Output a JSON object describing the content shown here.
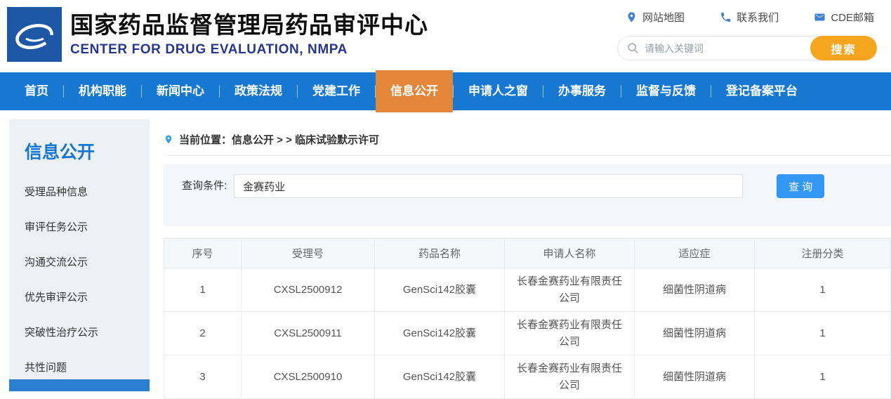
{
  "header": {
    "title": "国家药品监督管理局药品审评中心",
    "subtitle": "CENTER FOR DRUG EVALUATION, NMPA",
    "quick_links": [
      {
        "label": "网站地图"
      },
      {
        "label": "联系我们"
      },
      {
        "label": "CDE邮箱"
      }
    ],
    "search": {
      "placeholder": "请输入关键词",
      "button_label": "搜索"
    }
  },
  "nav": {
    "items": [
      {
        "label": "首页"
      },
      {
        "label": "机构职能"
      },
      {
        "label": "新闻中心"
      },
      {
        "label": "政策法规"
      },
      {
        "label": "党建工作"
      },
      {
        "label": "信息公开",
        "active": true
      },
      {
        "label": "申请人之窗"
      },
      {
        "label": "办事服务"
      },
      {
        "label": "监督与反馈"
      },
      {
        "label": "登记备案平台"
      }
    ]
  },
  "sidebar": {
    "title": "信息公开",
    "items": [
      "受理品种信息",
      "审评任务公示",
      "沟通交流公示",
      "优先审评公示",
      "突破性治疗公示",
      "共性问题"
    ]
  },
  "breadcrumb": {
    "text": "当前位置：信息公开 > > 临床试验默示许可"
  },
  "query": {
    "label": "查询条件:",
    "value": "金赛药业",
    "button_label": "查 询"
  },
  "table": {
    "headers": [
      "序号",
      "受理号",
      "药品名称",
      "申请人名称",
      "适应症",
      "注册分类"
    ],
    "rows": [
      [
        "1",
        "CXSL2500912",
        "GenSci142胶囊",
        "长春金赛药业有限责任公司",
        "细菌性阴道病",
        "1"
      ],
      [
        "2",
        "CXSL2500911",
        "GenSci142胶囊",
        "长春金赛药业有限责任公司",
        "细菌性阴道病",
        "1"
      ],
      [
        "3",
        "CXSL2500910",
        "GenSci142胶囊",
        "长春金赛药业有限责任公司",
        "细菌性阴道病",
        "1"
      ]
    ]
  },
  "colors": {
    "nav_blue": "#1778d2",
    "active_orange": "#e2873a",
    "search_orange": "#f6a51f",
    "query_blue": "#3398f4",
    "logo_navy": "#1e57a5",
    "subtitle_navy": "#27368f",
    "sidebar_bg": "#edf1f6",
    "sidebar_active_blue": "#2b7fd0"
  }
}
